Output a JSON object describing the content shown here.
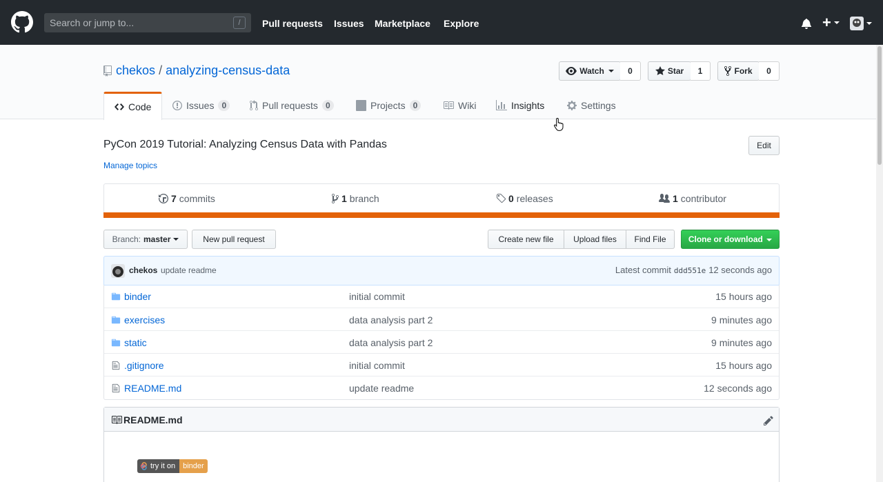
{
  "header": {
    "search_placeholder": "Search or jump to...",
    "search_shortcut": "/",
    "nav": [
      "Pull requests",
      "Issues",
      "Marketplace",
      "Explore"
    ]
  },
  "repo": {
    "owner": "chekos",
    "separator": "/",
    "name": "analyzing-census-data",
    "watch_label": "Watch",
    "watch_count": "0",
    "star_label": "Star",
    "star_count": "1",
    "fork_label": "Fork",
    "fork_count": "0"
  },
  "tabs": [
    {
      "label": "Code"
    },
    {
      "label": "Issues",
      "count": "0"
    },
    {
      "label": "Pull requests",
      "count": "0"
    },
    {
      "label": "Projects",
      "count": "0"
    },
    {
      "label": "Wiki"
    },
    {
      "label": "Insights"
    },
    {
      "label": "Settings"
    }
  ],
  "about": {
    "description": "PyCon 2019 Tutorial: Analyzing Census Data with Pandas",
    "edit_label": "Edit",
    "manage_topics": "Manage topics"
  },
  "summary": {
    "commits_num": "7",
    "commits_label": "commits",
    "branch_num": "1",
    "branch_label": "branch",
    "releases_num": "0",
    "releases_label": "releases",
    "contributor_num": "1",
    "contributor_label": "contributor"
  },
  "toolbar": {
    "branch_prefix": "Branch:",
    "branch_name": "master",
    "new_pr": "New pull request",
    "create_file": "Create new file",
    "upload_files": "Upload files",
    "find_file": "Find File",
    "clone": "Clone or download"
  },
  "latest_commit": {
    "author": "chekos",
    "message": "update readme",
    "prefix": "Latest commit",
    "sha": "ddd551e",
    "age": "12 seconds ago"
  },
  "files": [
    {
      "name": "binder",
      "type": "dir",
      "message": "initial commit",
      "age": "15 hours ago"
    },
    {
      "name": "exercises",
      "type": "dir",
      "message": "data analysis part 2",
      "age": "9 minutes ago"
    },
    {
      "name": "static",
      "type": "dir",
      "message": "data analysis part 2",
      "age": "9 minutes ago"
    },
    {
      "name": ".gitignore",
      "type": "file",
      "message": "initial commit",
      "age": "15 hours ago"
    },
    {
      "name": "README.md",
      "type": "file",
      "message": "update readme",
      "age": "12 seconds ago"
    }
  ],
  "readme": {
    "title": "README.md",
    "badge_left": "try it on",
    "badge_right": "binder"
  },
  "colors": {
    "header_bg": "#24292e",
    "link": "#0366d6",
    "accent_orange": "#e36209",
    "clone_green": "#28a745"
  }
}
